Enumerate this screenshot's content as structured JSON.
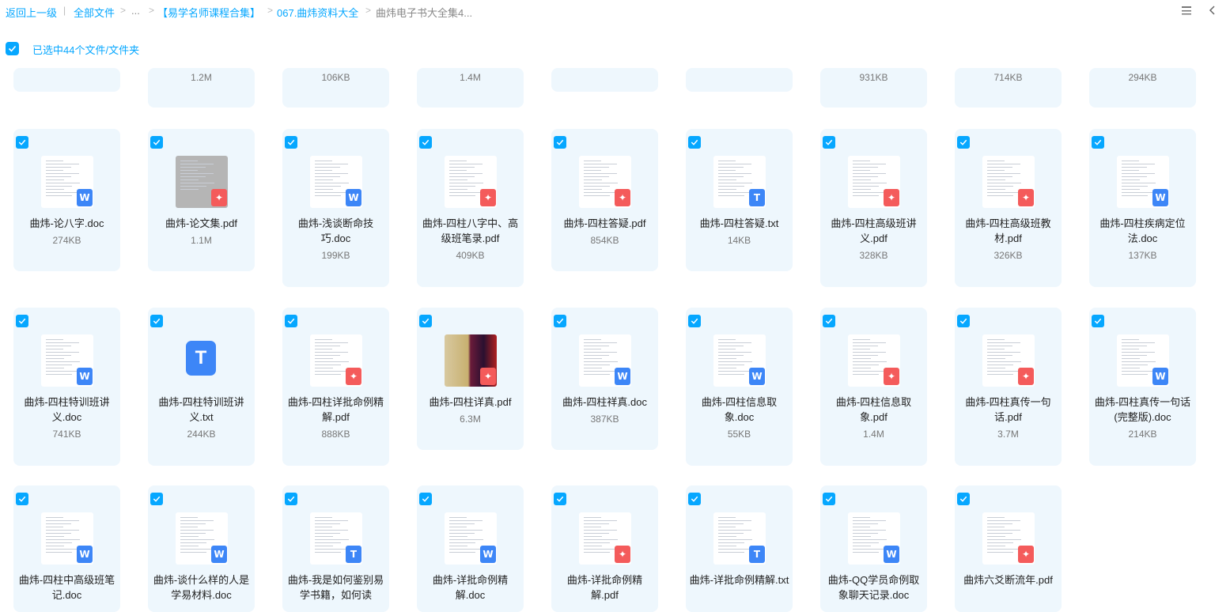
{
  "breadcrumb": {
    "back": "返回上一级",
    "all_files": "全部文件",
    "ellipsis": "...",
    "folder1": "【易学名师课程合集】",
    "folder2": "067.曲炜资料大全",
    "current": "曲炜电子书大全集4..."
  },
  "toolbar_icons": [
    "list-view-icon",
    "chevron-left-icon"
  ],
  "selection": {
    "text": "已选中44个文件/文件夹",
    "checked": true
  },
  "top_row_sizes": [
    "",
    "1.2M",
    "106KB",
    "1.4M",
    "",
    "",
    "931KB",
    "714KB",
    "294KB"
  ],
  "files": [
    {
      "name": "曲炜-论八字.doc",
      "size": "274KB",
      "type": "doc"
    },
    {
      "name": "曲炜-论文集.pdf",
      "size": "1.1M",
      "type": "pdf"
    },
    {
      "name": "曲炜-浅谈断命技巧.doc",
      "size": "199KB",
      "type": "doc"
    },
    {
      "name": "曲炜-四柱八字中、高级班笔录.pdf",
      "size": "409KB",
      "type": "pdf"
    },
    {
      "name": "曲炜-四柱答疑.pdf",
      "size": "854KB",
      "type": "pdf"
    },
    {
      "name": "曲炜-四柱答疑.txt",
      "size": "14KB",
      "type": "txt"
    },
    {
      "name": "曲炜-四柱高级班讲义.pdf",
      "size": "328KB",
      "type": "pdf"
    },
    {
      "name": "曲炜-四柱高级班教材.pdf",
      "size": "326KB",
      "type": "pdf"
    },
    {
      "name": "曲炜-四柱疾病定位法.doc",
      "size": "137KB",
      "type": "doc"
    },
    {
      "name": "曲炜-四柱特训班讲义.doc",
      "size": "741KB",
      "type": "doc"
    },
    {
      "name": "曲炜-四柱特训班讲义.txt",
      "size": "244KB",
      "type": "txt-big"
    },
    {
      "name": "曲炜-四柱详批命例精解.pdf",
      "size": "888KB",
      "type": "pdf"
    },
    {
      "name": "曲炜-四柱详真.pdf",
      "size": "6.3M",
      "type": "pdf-cover"
    },
    {
      "name": "曲炜-四柱祥真.doc",
      "size": "387KB",
      "type": "doc"
    },
    {
      "name": "曲炜-四柱信息取象.doc",
      "size": "55KB",
      "type": "doc"
    },
    {
      "name": "曲炜-四柱信息取象.pdf",
      "size": "1.4M",
      "type": "pdf"
    },
    {
      "name": "曲炜-四柱真传一句话.pdf",
      "size": "3.7M",
      "type": "pdf"
    },
    {
      "name": "曲炜-四柱真传一句话(完整版).doc",
      "size": "214KB",
      "type": "doc"
    },
    {
      "name": "曲炜-四柱中高级班笔记.doc",
      "size": "",
      "type": "doc"
    },
    {
      "name": "曲炜-谈什么样的人是学易材料.doc",
      "size": "",
      "type": "doc"
    },
    {
      "name": "曲炜-我是如何鉴别易学书籍，如何读",
      "size": "",
      "type": "txt"
    },
    {
      "name": "曲炜-详批命例精解.doc",
      "size": "",
      "type": "doc"
    },
    {
      "name": "曲炜-详批命例精解.pdf",
      "size": "",
      "type": "pdf"
    },
    {
      "name": "曲炜-详批命例精解.txt",
      "size": "",
      "type": "txt"
    },
    {
      "name": "曲炜-QQ学员命例取象聊天记录.doc",
      "size": "",
      "type": "doc"
    },
    {
      "name": "曲炜六爻断流年.pdf",
      "size": "",
      "type": "pdf"
    }
  ]
}
